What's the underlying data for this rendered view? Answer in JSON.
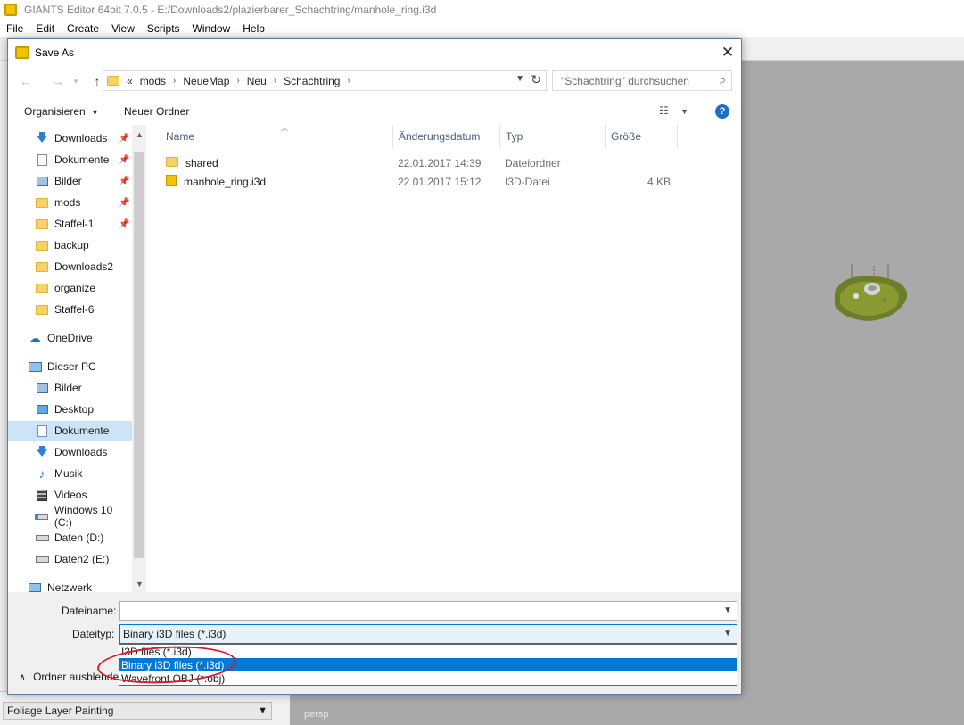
{
  "app": {
    "title": "GIANTS Editor 64bit 7.0.5 - E:/Downloads2/plazierbarer_Schachtring/manhole_ring.i3d",
    "menu": [
      "File",
      "Edit",
      "Create",
      "View",
      "Scripts",
      "Window",
      "Help"
    ],
    "foliage_label": "Foliage Layer Painting",
    "viewport_label": "persp"
  },
  "dialog": {
    "title": "Save As",
    "address": {
      "overflow": "«",
      "crumbs": [
        "mods",
        "NeueMap",
        "Neu",
        "Schachtring"
      ]
    },
    "search_placeholder": "\"Schachtring\" durchsuchen",
    "commands": {
      "organize": "Organisieren",
      "new_folder": "Neuer Ordner"
    },
    "nav": {
      "quick": [
        {
          "label": "Downloads",
          "icon": "download-arrow-icon",
          "pinned": true
        },
        {
          "label": "Dokumente",
          "icon": "document-icon",
          "pinned": true
        },
        {
          "label": "Bilder",
          "icon": "pictures-icon",
          "pinned": true
        },
        {
          "label": "mods",
          "icon": "folder-icon",
          "pinned": true
        },
        {
          "label": "Staffel-1",
          "icon": "folder-icon",
          "pinned": true
        },
        {
          "label": "backup",
          "icon": "folder-icon",
          "pinned": false
        },
        {
          "label": "Downloads2",
          "icon": "folder-icon",
          "pinned": false
        },
        {
          "label": "organize",
          "icon": "folder-icon",
          "pinned": false
        },
        {
          "label": "Staffel-6",
          "icon": "folder-icon",
          "pinned": false
        }
      ],
      "onedrive": "OneDrive",
      "this_pc": "Dieser PC",
      "pc_items": [
        {
          "label": "Bilder",
          "icon": "pictures-icon",
          "selected": false
        },
        {
          "label": "Desktop",
          "icon": "desktop-icon",
          "selected": false
        },
        {
          "label": "Dokumente",
          "icon": "document-icon",
          "selected": true
        },
        {
          "label": "Downloads",
          "icon": "download-arrow-icon",
          "selected": false
        },
        {
          "label": "Musik",
          "icon": "music-note-icon",
          "selected": false
        },
        {
          "label": "Videos",
          "icon": "video-icon",
          "selected": false
        },
        {
          "label": "Windows 10 (C:)",
          "icon": "windows-drive-icon",
          "selected": false
        },
        {
          "label": "Daten (D:)",
          "icon": "drive-icon",
          "selected": false
        },
        {
          "label": "Daten2 (E:)",
          "icon": "drive-icon",
          "selected": false
        }
      ],
      "network": "Netzwerk"
    },
    "columns": {
      "name": "Name",
      "date": "Änderungsdatum",
      "type": "Typ",
      "size": "Größe"
    },
    "files": [
      {
        "name": "shared",
        "date": "22.01.2017 14:39",
        "type": "Dateiordner",
        "size": "",
        "icon": "folder-icon"
      },
      {
        "name": "manhole_ring.i3d",
        "date": "22.01.2017 15:12",
        "type": "I3D-Datei",
        "size": "4 KB",
        "icon": "i3d-file-icon"
      }
    ],
    "filename_label": "Dateiname:",
    "filename_value": "",
    "filetype_label": "Dateityp:",
    "filetype_value": "Binary i3D files (*.i3d)",
    "filetype_options": [
      {
        "label": "I3D files (*.i3d)",
        "selected": false
      },
      {
        "label": "Binary i3D files (*.i3d)",
        "selected": true
      },
      {
        "label": "Wavefront OBJ (*.obj)",
        "selected": false
      }
    ],
    "hide_folders": "Ordner ausblende"
  }
}
